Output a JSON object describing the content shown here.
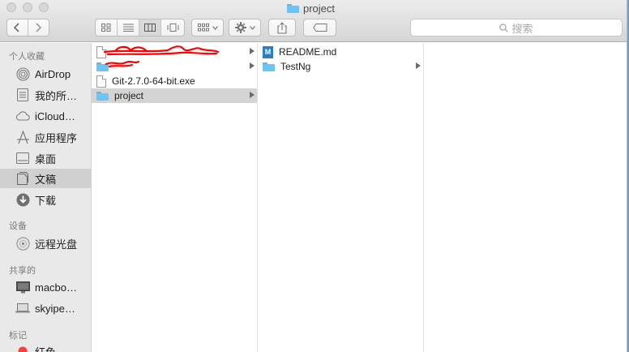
{
  "window": {
    "title": "project"
  },
  "toolbar": {
    "back_icon": "chevron-left",
    "forward_icon": "chevron-right",
    "views": [
      "icon-view",
      "list-view",
      "column-view",
      "cover-flow-view"
    ],
    "active_view": "column-view",
    "search_placeholder": "搜索"
  },
  "sidebar": {
    "sections": [
      {
        "title": "个人收藏",
        "items": [
          {
            "label": "AirDrop",
            "icon": "airdrop-icon"
          },
          {
            "label": "我的所…",
            "icon": "all-files-icon"
          },
          {
            "label": "iCloud…",
            "icon": "cloud-icon"
          },
          {
            "label": "应用程序",
            "icon": "applications-icon"
          },
          {
            "label": "桌面",
            "icon": "desktop-icon"
          },
          {
            "label": "文稿",
            "icon": "documents-icon",
            "selected": true
          },
          {
            "label": "下载",
            "icon": "downloads-icon"
          }
        ]
      },
      {
        "title": "设备",
        "items": [
          {
            "label": "远程光盘",
            "icon": "disc-icon"
          }
        ]
      },
      {
        "title": "共享的",
        "items": [
          {
            "label": "macbo…",
            "icon": "computer-icon"
          },
          {
            "label": "skyipe…",
            "icon": "laptop-icon"
          }
        ]
      },
      {
        "title": "标记",
        "items": [
          {
            "label": "红色",
            "icon": "red-tag-icon",
            "color": "#fc3d39"
          }
        ]
      }
    ]
  },
  "columns": [
    {
      "items": [
        {
          "label": "",
          "icon": "document-icon",
          "redacted": true,
          "has_children": true
        },
        {
          "label": "",
          "icon": "folder-icon",
          "redacted": true,
          "has_children": true
        },
        {
          "label": "Git-2.7.0-64-bit.exe",
          "icon": "document-icon"
        },
        {
          "label": "project",
          "icon": "folder-icon",
          "selected": true,
          "has_children": true
        }
      ]
    },
    {
      "items": [
        {
          "label": "README.md",
          "icon": "markdown-file-icon"
        },
        {
          "label": "TestNg",
          "icon": "folder-icon",
          "has_children": true
        }
      ]
    }
  ],
  "colors": {
    "folder": "#6cc4f5",
    "selection": "#d4d4d4",
    "sidebar_bg": "#e9e9e9",
    "redaction": "#ff0000"
  }
}
